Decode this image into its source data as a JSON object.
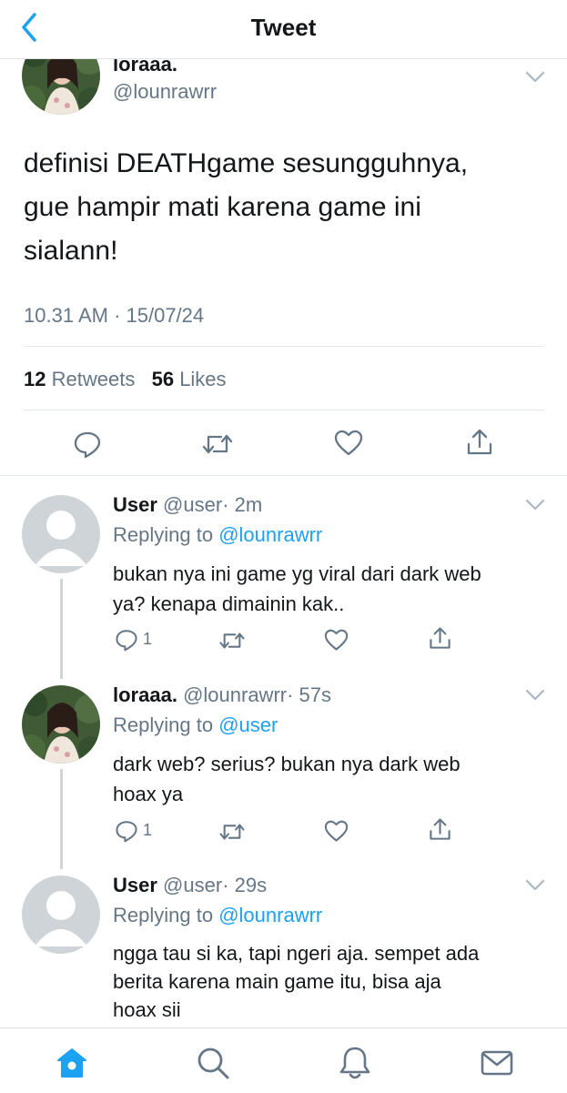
{
  "header": {
    "title": "Tweet"
  },
  "tweet": {
    "display_name": "loraaa.",
    "handle": "@lounrawrr",
    "text_lines": [
      "definisi DEATHgame sesungguhnya,",
      "gue hampir mati karena game ini",
      "sialann!"
    ],
    "timestamp": "10.31 AM · 15/07/24",
    "retweets_count": "12",
    "retweets_label": "Retweets",
    "likes_count": "56",
    "likes_label": "Likes"
  },
  "replies": [
    {
      "name": "User",
      "handle": "@user",
      "time": "· 2m",
      "replying_label": "Replying to",
      "replying_to": "@lounrawrr",
      "text_lines": [
        "bukan nya ini game yg viral dari dark web",
        "ya? kenapa dimainin kak.."
      ],
      "reply_count": "1"
    },
    {
      "name": "loraaa.",
      "handle": "@lounrawrr",
      "time": "· 57s",
      "replying_label": "Replying to",
      "replying_to": "@user",
      "text_lines": [
        "dark web? serius? bukan nya dark web",
        "hoax ya"
      ],
      "reply_count": "1"
    },
    {
      "name": "User",
      "handle": "@user",
      "time": "· 29s",
      "replying_label": "Replying to",
      "replying_to": "@lounrawrr",
      "text_lines": [
        "ngga tau si ka, tapi ngeri aja. sempet ada",
        "berita karena main game itu, bisa aja",
        "hoax sii"
      ]
    }
  ],
  "icons": {
    "back": "chevron-left-icon",
    "more": "chevron-down-icon",
    "reply": "comment-icon",
    "retweet": "retweet-icon",
    "like": "heart-icon",
    "share": "share-icon",
    "home": "home-icon",
    "search": "search-icon",
    "notifications": "bell-icon",
    "messages": "mail-icon"
  },
  "colors": {
    "accent": "#1da1f2",
    "text": "#14171a",
    "muted": "#657786",
    "divider": "#e1e8ed",
    "icon": "#657786"
  }
}
